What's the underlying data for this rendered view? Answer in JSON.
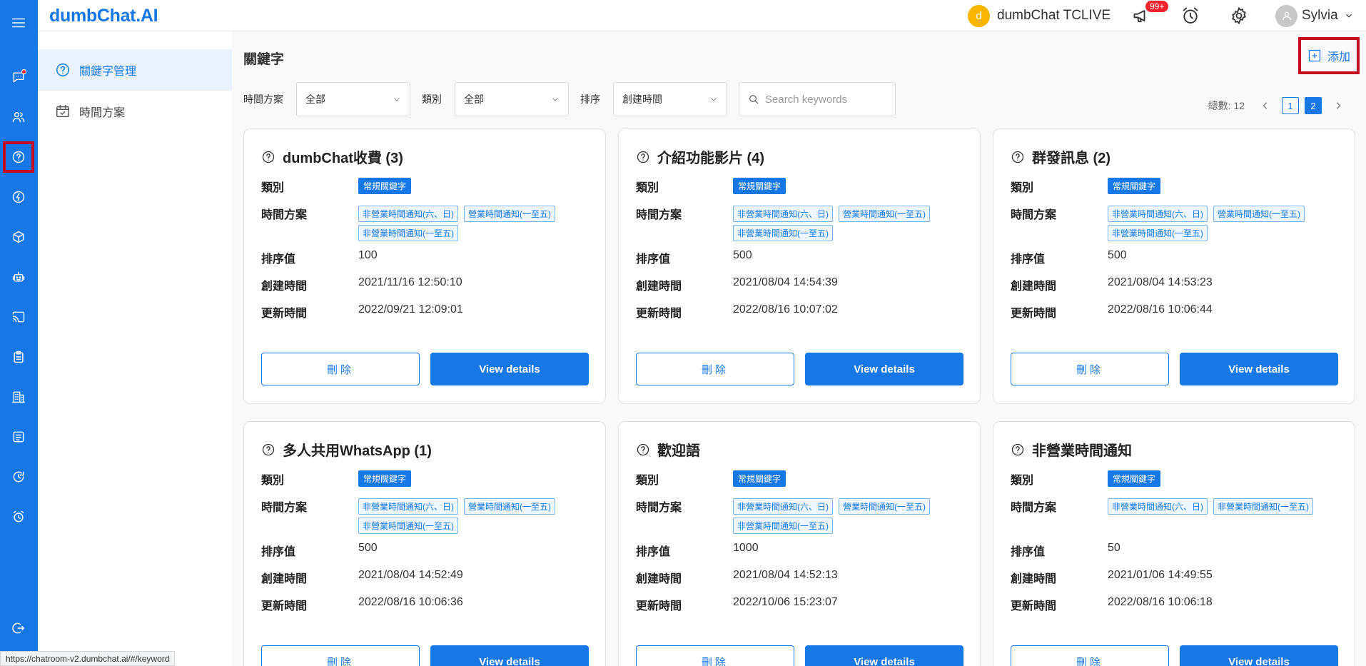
{
  "app": {
    "logo": "dumbChat.AI"
  },
  "topbar": {
    "org_avatar_letter": "d",
    "org_name": "dumbChat TCLIVE",
    "notification_badge": "99+",
    "user_name": "Sylvia"
  },
  "subnav": {
    "items": [
      {
        "label": "關鍵字管理",
        "icon": "help-circle-icon",
        "active": true
      },
      {
        "label": "時間方案",
        "icon": "calendar-check-icon",
        "active": false
      }
    ]
  },
  "page": {
    "title": "關鍵字",
    "add_label": "添加",
    "filters": {
      "time_plan_label": "時間方案",
      "time_plan_value": "全部",
      "category_label": "類別",
      "category_value": "全部",
      "sort_label": "排序",
      "sort_value": "創建時間",
      "search_placeholder": "Search keywords"
    },
    "pager": {
      "total": "總數: 12",
      "pages": [
        "1",
        "2"
      ],
      "current": "2"
    }
  },
  "labels": {
    "category": "類別",
    "time_plan": "時間方案",
    "sort_value": "排序值",
    "created": "創建時間",
    "updated": "更新時間",
    "delete": "刪除",
    "view": "View details"
  },
  "cards": [
    {
      "title": "dumbChat收費 (3)",
      "category": "常規關鍵字",
      "tags": [
        "非營業時間通知(六、日)",
        "營業時間通知(一至五)",
        "非營業時間通知(一至五)"
      ],
      "sort": "100",
      "created": "2021/11/16 12:50:10",
      "updated": "2022/09/21 12:09:01"
    },
    {
      "title": "介紹功能影片 (4)",
      "category": "常規關鍵字",
      "tags": [
        "非營業時間通知(六、日)",
        "營業時間通知(一至五)",
        "非營業時間通知(一至五)"
      ],
      "sort": "500",
      "created": "2021/08/04 14:54:39",
      "updated": "2022/08/16 10:07:02"
    },
    {
      "title": "群發訊息 (2)",
      "category": "常規關鍵字",
      "tags": [
        "非營業時間通知(六、日)",
        "營業時間通知(一至五)",
        "非營業時間通知(一至五)"
      ],
      "sort": "500",
      "created": "2021/08/04 14:53:23",
      "updated": "2022/08/16 10:06:44"
    },
    {
      "title": "多人共用WhatsApp (1)",
      "category": "常規關鍵字",
      "tags": [
        "非營業時間通知(六、日)",
        "營業時間通知(一至五)",
        "非營業時間通知(一至五)"
      ],
      "sort": "500",
      "created": "2021/08/04 14:52:49",
      "updated": "2022/08/16 10:06:36"
    },
    {
      "title": "歡迎語",
      "category": "常規關鍵字",
      "tags": [
        "非營業時間通知(六、日)",
        "營業時間通知(一至五)",
        "非營業時間通知(一至五)"
      ],
      "sort": "1000",
      "created": "2021/08/04 14:52:13",
      "updated": "2022/10/06 15:23:07"
    },
    {
      "title": "非營業時間通知",
      "category": "常規關鍵字",
      "tags": [
        "非營業時間通知(六、日)",
        "非營業時間通知(一至五)"
      ],
      "sort": "50",
      "created": "2021/01/06 14:49:55",
      "updated": "2022/08/16 10:06:18"
    }
  ],
  "status_url": "https://chatroom-v2.dumbchat.ai/#/keyword",
  "colors": {
    "brand": "#1677e6",
    "highlight_box": "#c40d1e",
    "badge": "#f5222d",
    "org_avatar": "#f7b500"
  }
}
